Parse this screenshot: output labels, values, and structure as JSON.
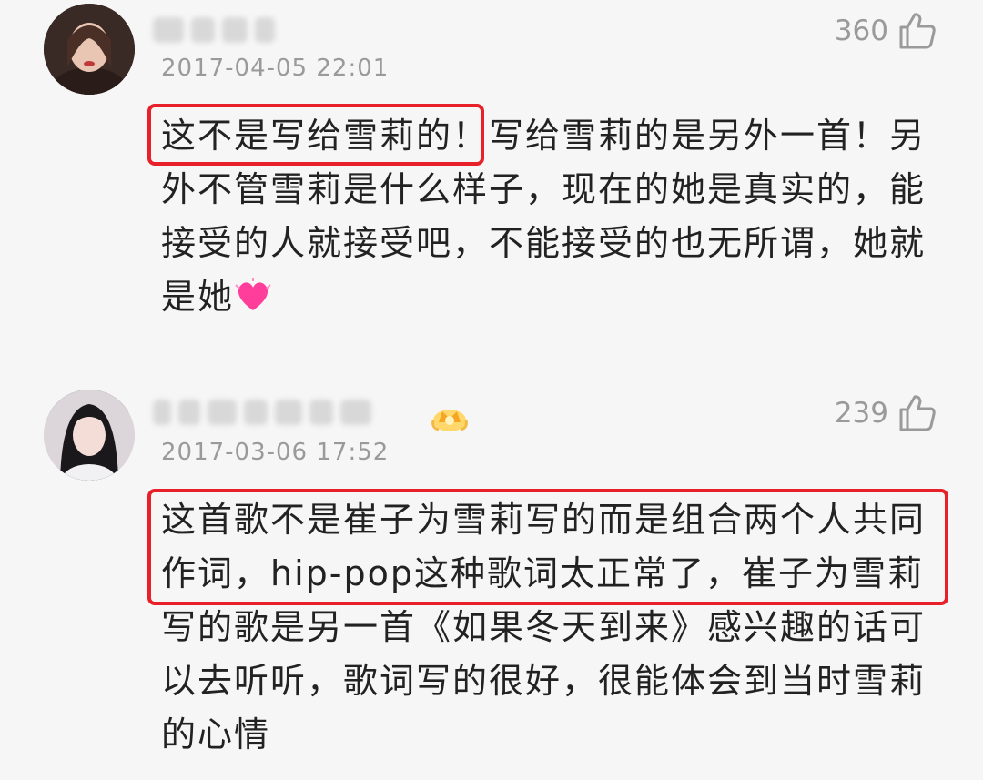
{
  "comments": [
    {
      "date": "2017-04-05 22:01",
      "likes": "360",
      "line1_highlight": "这不是写给雪莉的！",
      "text_rest": "写给雪莉的是另外一首！另外不管雪莉是什么样子，现在的她是真实的，能接受的人就接受吧，不能接受的也无所谓，她就是她",
      "emoji": "pink-heart"
    },
    {
      "date": "2017-03-06 17:52",
      "likes": "239",
      "badge": "crown-badge",
      "text_highlight": "这首歌不是崔子为雪莉写的而是组合两个人共同作词，hip-pop这种歌词太正常了，崔子为雪莉",
      "text_rest": "写的歌是另一首《如果冬天到来》感兴趣的话可以去听听，歌词写的很好，很能体会到当时雪莉的心情"
    }
  ],
  "colors": {
    "highlight_border": "#e8202a",
    "meta_gray": "#9a9a9a",
    "background": "#f6f6f6"
  }
}
